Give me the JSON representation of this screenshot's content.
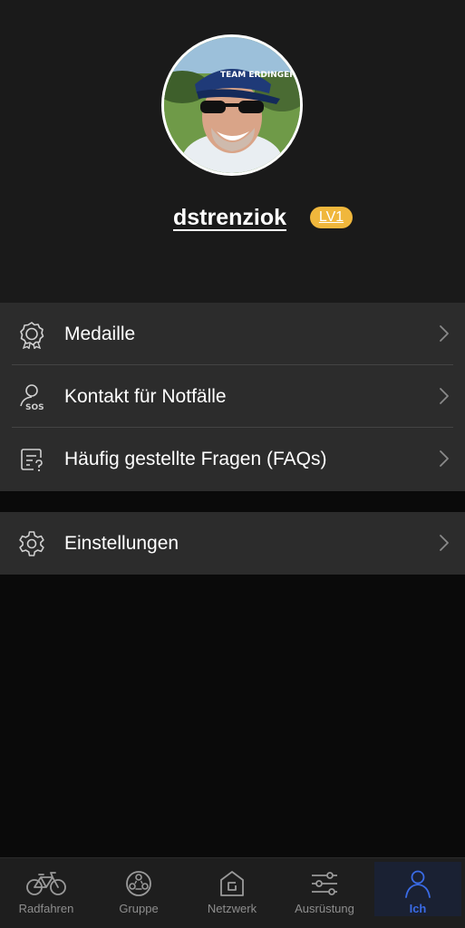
{
  "profile": {
    "username": "dstrenziok",
    "level_badge": "LV1",
    "cap_text": "TEAM ERDINGER"
  },
  "menu": {
    "group1": [
      {
        "label": "Medaille",
        "icon": "medal-icon"
      },
      {
        "label": "Kontakt für Notfälle",
        "icon": "sos-contact-icon",
        "icon_text": "SOS"
      },
      {
        "label": "Häufig gestellte Fragen (FAQs)",
        "icon": "faq-document-icon"
      }
    ],
    "group2": [
      {
        "label": "Einstellungen",
        "icon": "gear-icon"
      }
    ]
  },
  "tabbar": {
    "active": "Ich",
    "tabs": [
      {
        "label": "Radfahren",
        "icon": "bicycle-icon"
      },
      {
        "label": "Gruppe",
        "icon": "group-icon"
      },
      {
        "label": "Netzwerk",
        "icon": "network-icon"
      },
      {
        "label": "Ausrüstung",
        "icon": "equipment-sliders-icon"
      },
      {
        "label": "Ich",
        "icon": "person-icon"
      }
    ]
  },
  "colors": {
    "background": "#0a0a0a",
    "header_bg": "#1a1a1a",
    "menu_bg": "#2c2c2c",
    "badge": "#f0b73c",
    "accent": "#3a6be6"
  }
}
